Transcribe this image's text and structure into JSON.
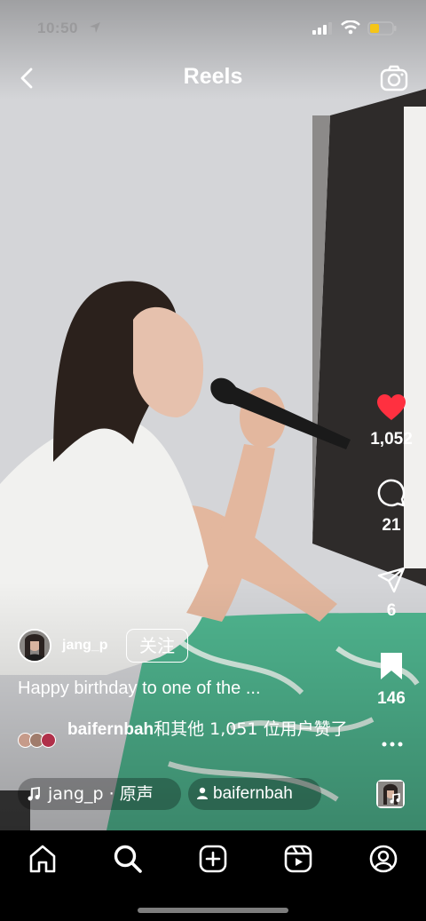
{
  "status_bar": {
    "time": "10:50"
  },
  "header": {
    "title": "Reels"
  },
  "actions": {
    "likes": "1,052",
    "comments": "21",
    "shares": "6",
    "saves": "146"
  },
  "post": {
    "username": "jang_p",
    "follow_label": "关注",
    "caption": "Happy birthday to one of the ...",
    "likers": {
      "name": "baifernbah",
      "rest": "和其他 1,051 位用户赞了"
    }
  },
  "audio": {
    "label": "jang_p · 原声",
    "tagged_user": "baifernbah"
  },
  "colors": {
    "like_red": "#ff3040",
    "bottom_bar": "#000000"
  },
  "icons": [
    "back-icon",
    "camera-icon",
    "heart-icon",
    "comment-icon",
    "share-icon",
    "bookmark-icon",
    "more-icon",
    "music-note-icon",
    "person-icon",
    "home-icon",
    "search-icon",
    "create-icon",
    "reels-icon",
    "profile-icon"
  ]
}
